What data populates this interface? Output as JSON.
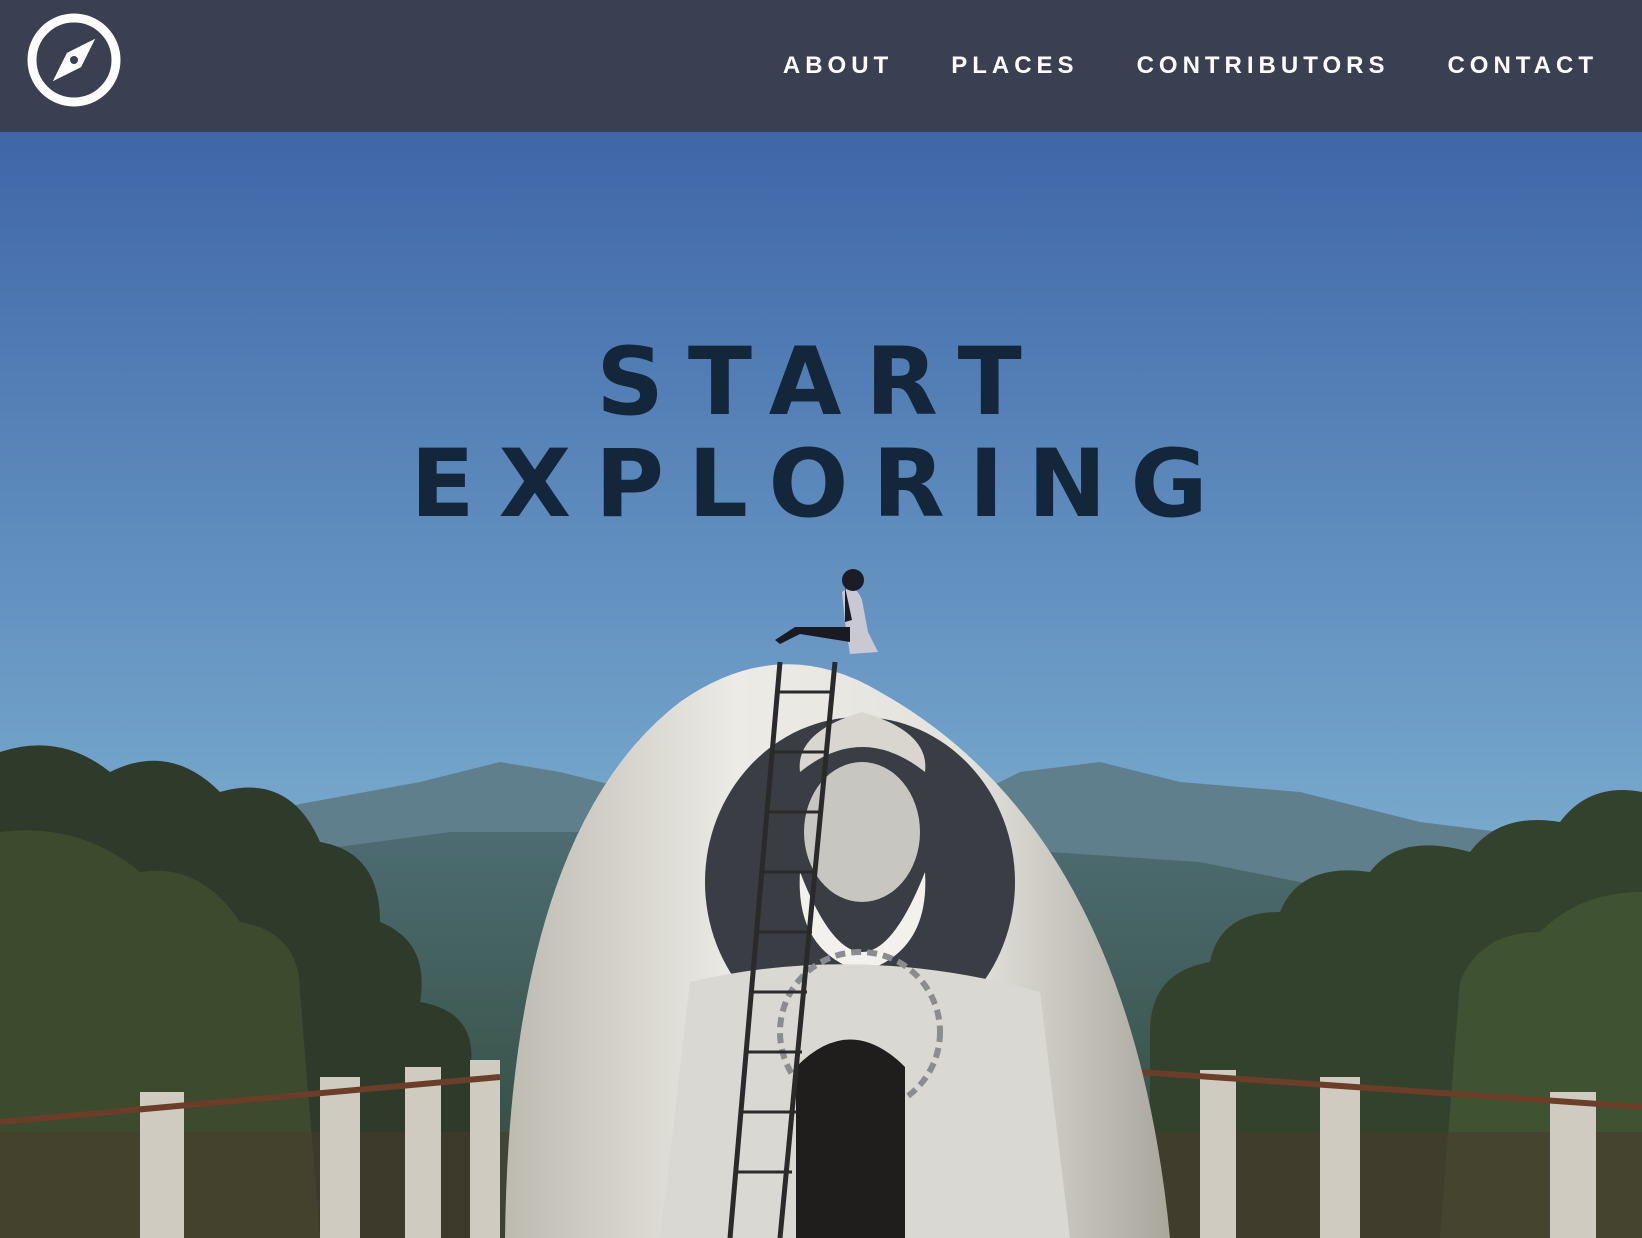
{
  "nav": {
    "logo_icon": "compass-icon",
    "links": [
      {
        "label": "ABOUT"
      },
      {
        "label": "PLACES"
      },
      {
        "label": "CONTRIBUTORS"
      },
      {
        "label": "CONTACT"
      }
    ]
  },
  "hero": {
    "title_line1": "START",
    "title_line2": "EXPLORING"
  },
  "colors": {
    "navbar_bg": "#3b3f52",
    "nav_text": "#ffffff",
    "hero_title": "#14263a",
    "sky_top": "#3f66a8",
    "sky_bottom": "#7fb0cc"
  }
}
